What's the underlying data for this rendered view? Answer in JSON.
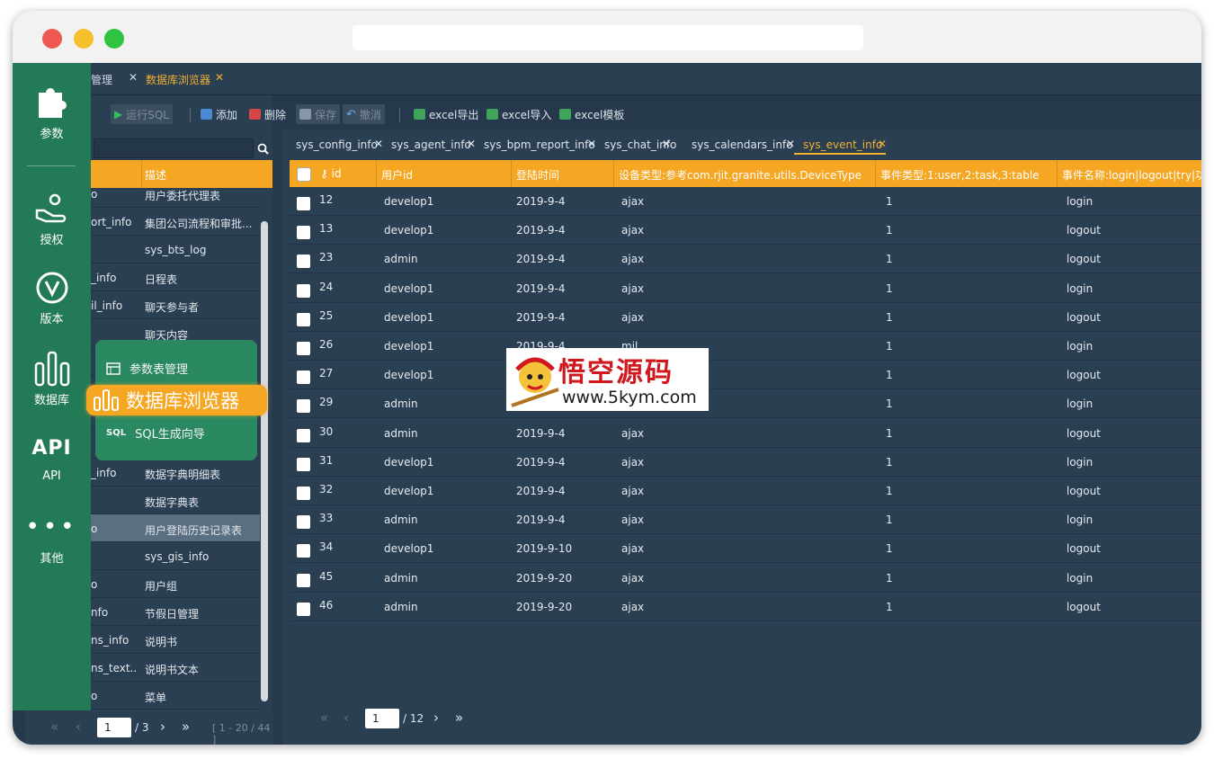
{
  "rail": {
    "items": [
      {
        "label": "参数",
        "icon": "puzzle-icon"
      },
      {
        "label": "授权",
        "icon": "hand-key-icon"
      },
      {
        "label": "版本",
        "icon": "version-icon"
      },
      {
        "label": "数据库",
        "icon": "database-icon"
      },
      {
        "label": "API",
        "icon": "api-icon"
      },
      {
        "label": "其他",
        "icon": "more-icon"
      }
    ]
  },
  "top_tabs": [
    {
      "label": "管理",
      "active": false
    },
    {
      "label": "数据库浏览器",
      "active": true
    }
  ],
  "toolbar": {
    "run_sql": "运行SQL",
    "add": "添加",
    "delete": "删除",
    "save": "保存",
    "undo": "撤消",
    "excel_export": "excel导出",
    "excel_import": "excel导入",
    "excel_template": "excel模板"
  },
  "left_table": {
    "header_desc": "描述",
    "rows": [
      {
        "name": "o",
        "desc": "用户委托代理表"
      },
      {
        "name": "ort_info",
        "desc": "集团公司流程和审批..."
      },
      {
        "name": "",
        "desc": "sys_bts_log"
      },
      {
        "name": "_info",
        "desc": "日程表"
      },
      {
        "name": "il_info",
        "desc": "聊天参与者"
      },
      {
        "name": "",
        "desc": "聊天内容"
      },
      {
        "name": "",
        "desc": ""
      },
      {
        "name": "",
        "desc": ""
      },
      {
        "name": "",
        "desc": ""
      },
      {
        "name": "",
        "desc": ""
      },
      {
        "name": "_info",
        "desc": "数据字典明细表"
      },
      {
        "name": "",
        "desc": "数据字典表"
      },
      {
        "name": "o",
        "desc": "用户登陆历史记录表"
      },
      {
        "name": "",
        "desc": "sys_gis_info"
      },
      {
        "name": "o",
        "desc": "用户组"
      },
      {
        "name": "nfo",
        "desc": "节假日管理"
      },
      {
        "name": "ns_info",
        "desc": "说明书"
      },
      {
        "name": "ns_text...",
        "desc": "说明书文本"
      },
      {
        "name": "o",
        "desc": "菜单"
      }
    ],
    "selected_index": 12
  },
  "left_pager": {
    "page": "1",
    "total": "/ 3",
    "range": "[ 1 - 20 / 44 ]"
  },
  "popup": {
    "items": [
      {
        "label": "参数表管理",
        "icon": "table-icon"
      },
      {
        "label": "数据库浏览器",
        "icon": "database-icon"
      },
      {
        "label": "SQL生成向导",
        "icon": "sql-icon"
      }
    ]
  },
  "right_tabs": [
    {
      "label": "sys_config_info",
      "active": false
    },
    {
      "label": "sys_agent_info",
      "active": false
    },
    {
      "label": "sys_bpm_report_info",
      "active": false
    },
    {
      "label": "sys_chat_info",
      "active": false
    },
    {
      "label": "sys_calendars_info",
      "active": false
    },
    {
      "label": "sys_event_info",
      "active": true
    }
  ],
  "grid": {
    "columns": [
      "id",
      "用户id",
      "登陆时间",
      "设备类型:参考com.rjit.granite.utils.DeviceType",
      "事件类型:1:user,2:task,3:table",
      "事件名称:login|logout|try|功能名"
    ],
    "rows": [
      [
        "12",
        "develop1",
        "2019-9-4",
        "ajax",
        "1",
        "login"
      ],
      [
        "13",
        "develop1",
        "2019-9-4",
        "ajax",
        "1",
        "logout"
      ],
      [
        "23",
        "admin",
        "2019-9-4",
        "ajax",
        "1",
        "logout"
      ],
      [
        "24",
        "develop1",
        "2019-9-4",
        "ajax",
        "1",
        "login"
      ],
      [
        "25",
        "develop1",
        "2019-9-4",
        "ajax",
        "1",
        "logout"
      ],
      [
        "26",
        "develop1",
        "2019-9-4",
        "mil",
        "1",
        "login"
      ],
      [
        "27",
        "develop1",
        "",
        "",
        "1",
        "logout"
      ],
      [
        "29",
        "admin",
        "",
        "",
        "1",
        "login"
      ],
      [
        "30",
        "admin",
        "2019-9-4",
        "ajax",
        "1",
        "logout"
      ],
      [
        "31",
        "develop1",
        "2019-9-4",
        "ajax",
        "1",
        "login"
      ],
      [
        "32",
        "develop1",
        "2019-9-4",
        "ajax",
        "1",
        "logout"
      ],
      [
        "33",
        "admin",
        "2019-9-4",
        "ajax",
        "1",
        "login"
      ],
      [
        "34",
        "develop1",
        "2019-9-10",
        "ajax",
        "1",
        "logout"
      ],
      [
        "45",
        "admin",
        "2019-9-20",
        "ajax",
        "1",
        "login"
      ],
      [
        "46",
        "admin",
        "2019-9-20",
        "ajax",
        "1",
        "logout"
      ]
    ]
  },
  "right_pager": {
    "page": "1",
    "total": "/ 12"
  },
  "watermark": {
    "title": "悟空源码",
    "url": "www.5kym.com"
  },
  "colors": {
    "accent": "#f5a623",
    "rail": "#237a57",
    "panel": "#2b3f53"
  }
}
